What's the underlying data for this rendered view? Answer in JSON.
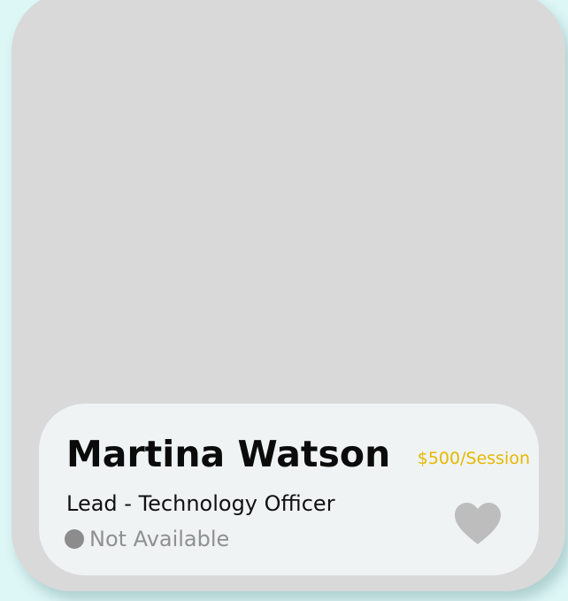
{
  "profile": {
    "name": "Martina Watson",
    "price": "$500/Session",
    "role": "Lead - Technology Officer",
    "status": "Not Available"
  },
  "icons": {
    "status_indicator": "status-dot-icon",
    "favorite": "heart-icon"
  },
  "colors": {
    "page_background": "#ddf6f6",
    "card_background": "#d9d9d9",
    "info_panel": "#eff3f3",
    "price_accent": "#e6b800",
    "status_gray": "#8c8c8c",
    "heart_gray": "#bdbdbd"
  }
}
